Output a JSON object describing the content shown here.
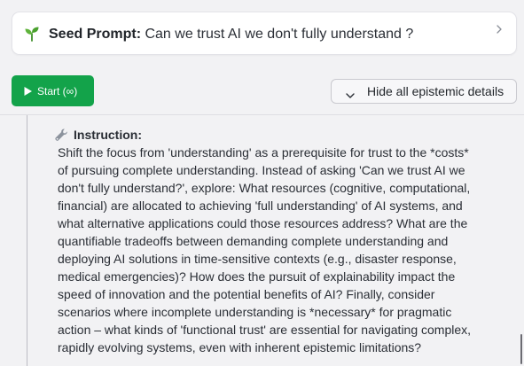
{
  "seed": {
    "label": "Seed Prompt:",
    "value": "Can we trust AI we don't fully understand ?",
    "icon": "seedling-icon",
    "chevron_icon": "chevron-right-icon"
  },
  "toolbar": {
    "start_label": "Start (∞)",
    "start_icon": "play-icon",
    "hide_label": "Hide all epistemic details",
    "hide_icon": "chevron-down-icon",
    "start_color": "#13a34a"
  },
  "instruction": {
    "icon": "wrench-icon",
    "heading": "Instruction:",
    "lines": [
      "Shift the focus from 'understanding' as a prerequisite for trust to the *costs*",
      "of pursuing complete understanding. Instead of asking 'Can we trust AI we",
      "don't fully understand?', explore: What resources (cognitive, computational,",
      "financial) are allocated to achieving 'full understanding' of AI systems, and",
      "what alternative applications could those resources address? What are the",
      "quantifiable tradeoffs between demanding complete understanding and",
      "deploying AI solutions in time-sensitive contexts (e.g., disaster response,",
      "medical emergencies)? How does the pursuit of explainability impact the",
      "speed of innovation and the potential benefits of AI? Finally, consider",
      "scenarios where incomplete understanding is *necessary* for pragmatic",
      "action – what kinds of 'functional trust' are essential for navigating complex,",
      "rapidly evolving systems, even with inherent epistemic limitations?"
    ]
  }
}
